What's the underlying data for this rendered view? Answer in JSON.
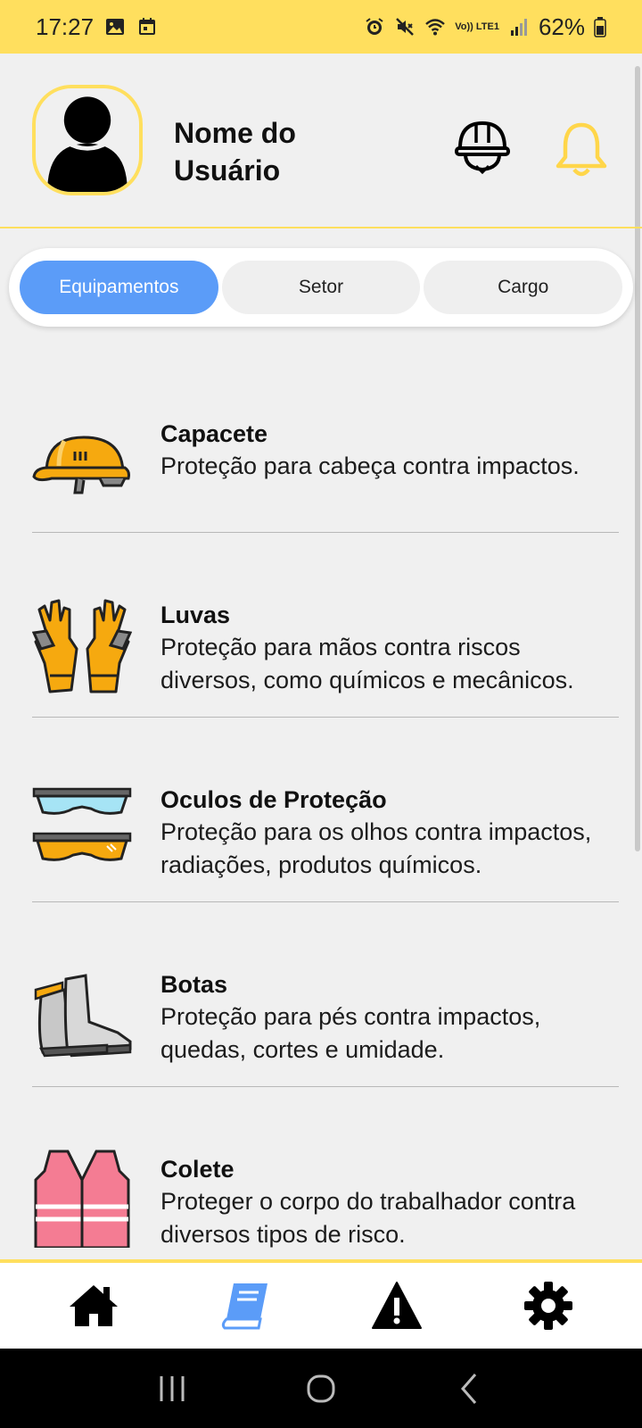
{
  "status_bar": {
    "time": "17:27",
    "battery": "62%",
    "network_label": "Vo)) LTE1"
  },
  "header": {
    "user_name": "Nome do Usuário"
  },
  "tabs": [
    {
      "label": "Equipamentos",
      "active": true
    },
    {
      "label": "Setor",
      "active": false
    },
    {
      "label": "Cargo",
      "active": false
    }
  ],
  "equipment": [
    {
      "title": "Capacete",
      "description": "Proteção para cabeça contra impactos.",
      "icon": "helmet-icon"
    },
    {
      "title": "Luvas",
      "description": "Proteção para mãos contra riscos diversos, como químicos e mecânicos.",
      "icon": "gloves-icon"
    },
    {
      "title": "Oculos de Proteção",
      "description": "Proteção para os olhos contra impactos, radiações, produtos químicos.",
      "icon": "goggles-icon"
    },
    {
      "title": "Botas",
      "description": "Proteção para pés contra impactos, quedas, cortes e umidade.",
      "icon": "boots-icon"
    },
    {
      "title": "Colete",
      "description": "Proteger o corpo do trabalhador contra diversos tipos de risco.",
      "icon": "vest-icon"
    }
  ],
  "bottom_nav": [
    {
      "icon": "home-icon",
      "active": false
    },
    {
      "icon": "book-icon",
      "active": true
    },
    {
      "icon": "warning-icon",
      "active": false
    },
    {
      "icon": "gear-icon",
      "active": false
    }
  ],
  "colors": {
    "accent_yellow": "#ffdf5e",
    "active_tab_blue": "#5b9cf8",
    "background": "#f0f0f0"
  }
}
